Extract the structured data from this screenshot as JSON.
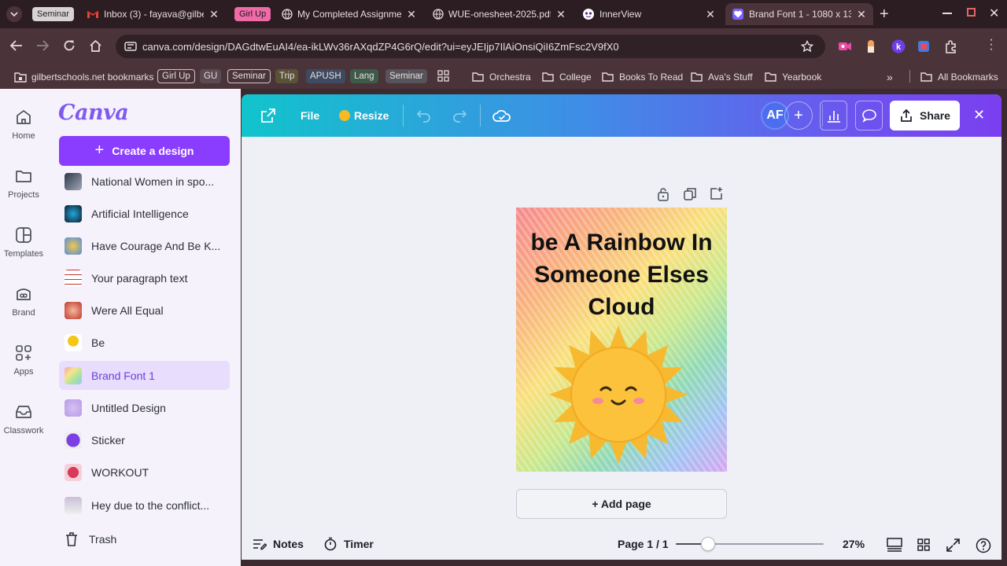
{
  "browser": {
    "tabs": [
      {
        "group": "Seminar",
        "title": "Inbox (3) - fayava@gilbe",
        "icon": "gmail-icon"
      },
      {
        "group": "Girl Up",
        "title": "My Completed Assignme",
        "icon": "globe-icon"
      },
      {
        "title": "WUE-onesheet-2025.pdf",
        "icon": "globe-icon"
      },
      {
        "title": "InnerView",
        "icon": "innerview-icon"
      },
      {
        "title": "Brand Font 1 - 1080 x 13",
        "icon": "canva-icon",
        "active": true
      }
    ],
    "url": "canva.com/design/DAGdtwEuAI4/ea-ikLWv36rAXqdZP4G6rQ/edit?ui=eyJEIjp7IlAiOnsiQiI6ZmFsc2V9fX0",
    "bookmarks": {
      "first": "gilbertschools.net bookmarks",
      "chips": [
        "Girl Up",
        "GU",
        "Seminar",
        "Trip",
        "APUSH",
        "Lang",
        "Seminar"
      ],
      "folders": [
        "Orchestra",
        "College",
        "Books To Read",
        "Ava's Stuff",
        "Yearbook"
      ],
      "all": "All Bookmarks"
    }
  },
  "rail": [
    {
      "label": "Home",
      "icon": "home-icon"
    },
    {
      "label": "Projects",
      "icon": "folder-icon"
    },
    {
      "label": "Templates",
      "icon": "templates-icon"
    },
    {
      "label": "Brand",
      "icon": "brand-icon"
    },
    {
      "label": "Apps",
      "icon": "apps-icon"
    },
    {
      "label": "Classwork",
      "icon": "classwork-icon"
    }
  ],
  "panel": {
    "logo": "Canva",
    "create_label": "Create a design",
    "projects": [
      "National Women in spo...",
      "Artificial Intelligence",
      "Have Courage And Be K...",
      "Your paragraph text",
      "Were All Equal",
      "Be",
      "Brand Font 1",
      "Untitled Design",
      "Sticker",
      "WORKOUT",
      "Hey due to the conflict..."
    ],
    "selected": "Brand Font 1",
    "trash_label": "Trash"
  },
  "header": {
    "file_label": "File",
    "resize_label": "Resize",
    "avatar": "AF",
    "share_label": "Share"
  },
  "canvas": {
    "text": "be A Rainbow In Someone Elses Cloud",
    "add_page_label": "+ Add page"
  },
  "footer": {
    "notes_label": "Notes",
    "timer_label": "Timer",
    "page_label": "Page 1 / 1",
    "zoom_label": "27%",
    "zoom_fraction": 0.27
  },
  "colors": {
    "accent": "#8b3dff",
    "selected_bg": "#e8ddfc",
    "chrome": "#4a343a"
  }
}
